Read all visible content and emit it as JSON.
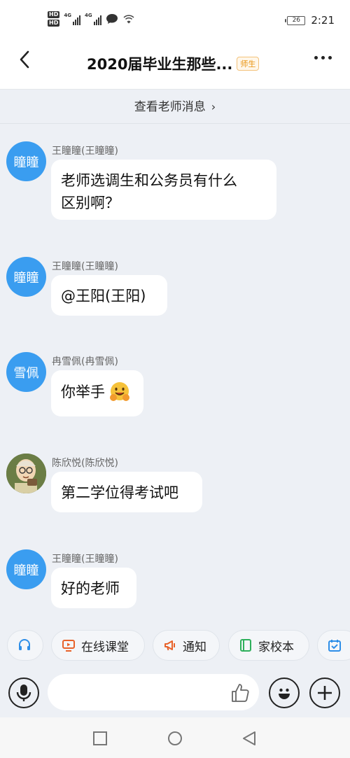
{
  "status_bar": {
    "time": "2:21",
    "battery": "26",
    "hd1": "HD",
    "hd2": "HD",
    "net1": "4G",
    "net2": "4G"
  },
  "nav": {
    "title": "2020届毕业生那些...",
    "tag": "师生",
    "back_icon": "chevron-left-icon",
    "more_icon": "more-dots-icon"
  },
  "teacher_bar": {
    "label": "查看老师消息",
    "chevron": "›"
  },
  "messages": [
    {
      "avatar_text": "瞳瞳",
      "sender": "王瞳瞳(王瞳瞳)",
      "lines": [
        "老师选调生和公务员有什么",
        "区别啊？"
      ]
    },
    {
      "avatar_text": "瞳瞳",
      "sender": "王瞳瞳(王瞳瞳)",
      "lines": [
        "@王阳(王阳)"
      ]
    },
    {
      "avatar_text": "雪佩",
      "sender": "冉雪佩(冉雪佩)",
      "lines": [
        "你举手"
      ],
      "emoji": "hugging-face-emoji"
    },
    {
      "avatar_icon": "cartoon-avatar-photo",
      "sender": "陈欣悦(陈欣悦)",
      "lines": [
        "第二学位得考试吧"
      ]
    },
    {
      "avatar_text": "瞳瞳",
      "sender": "王瞳瞳(王瞳瞳)",
      "lines": [
        "好的老师"
      ]
    }
  ],
  "shortcuts": [
    {
      "icon": "headset-icon",
      "label": ""
    },
    {
      "icon": "live-class-icon",
      "label": "在线课堂",
      "color": "#e8622a"
    },
    {
      "icon": "megaphone-icon",
      "label": "通知",
      "color": "#e8622a"
    },
    {
      "icon": "notebook-icon",
      "label": "家校本",
      "color": "#2fb05c"
    },
    {
      "icon": "calendar-check-icon",
      "label": "",
      "color": "#2f8fe8"
    }
  ],
  "input": {
    "placeholder": "",
    "voice_icon": "microphone-icon",
    "like_icon": "thumbs-up-icon",
    "emoji_icon": "smile-icon",
    "plus_icon": "plus-icon"
  },
  "system_nav": [
    "square-icon",
    "circle-icon",
    "triangle-back-icon"
  ],
  "colors": {
    "accent": "#3a9df0",
    "background": "#edf0f5",
    "tag": "#e8920e"
  }
}
